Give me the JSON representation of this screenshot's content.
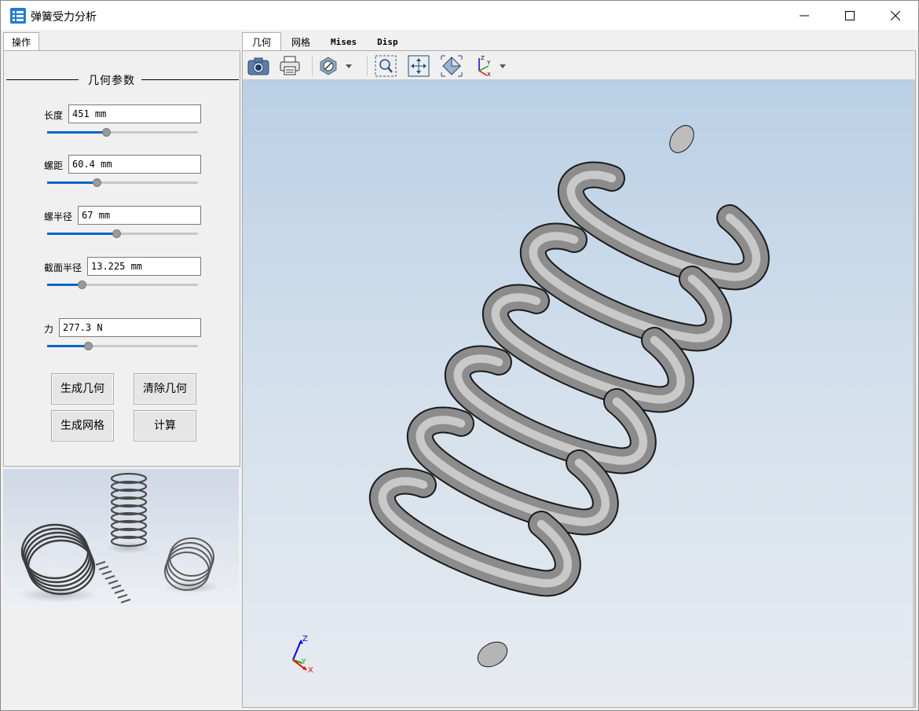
{
  "window": {
    "title": "弹簧受力分析",
    "icon": "app-spring-icon",
    "controls": [
      "minimize-icon",
      "maximize-icon",
      "close-icon"
    ]
  },
  "left_panel": {
    "tab_label": "操作",
    "group_title": "几何参数",
    "params": [
      {
        "label": "长度",
        "value": "451 mm",
        "slider_fraction": 0.39
      },
      {
        "label": "螺距",
        "value": "60.4 mm",
        "slider_fraction": 0.33
      },
      {
        "label": "螺半径",
        "value": "67 mm",
        "slider_fraction": 0.46
      },
      {
        "label": "截面半径",
        "value": "13.225 mm",
        "slider_fraction": 0.23
      },
      {
        "label": "力",
        "value": "277.3 N",
        "slider_fraction": 0.27
      }
    ],
    "buttons": {
      "generate_geometry": "生成几何",
      "clear_geometry": "清除几何",
      "generate_mesh": "生成网格",
      "compute": "计算"
    }
  },
  "right_panel": {
    "tabs": [
      "几何",
      "网格",
      "Mises",
      "Disp"
    ],
    "active_tab": "几何",
    "toolbar": [
      "screenshot-icon",
      "print-icon",
      "display-mode-icon",
      "zoom-box-icon",
      "fit-all-icon",
      "isometric-view-icon",
      "axes-view-icon"
    ]
  },
  "viewport": {
    "axis_labels": {
      "z": "Z",
      "y": "Y",
      "x": "X"
    },
    "colors": {
      "z": "#0000ff",
      "y": "#00aa00",
      "x": "#ff0000"
    },
    "background_top": "#bad0e6",
    "background_bottom": "#e7ebf0"
  }
}
